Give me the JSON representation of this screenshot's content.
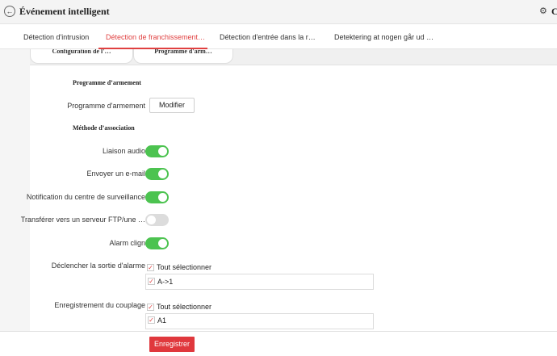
{
  "header": {
    "back_icon": "back-arrow-icon",
    "title": "Événement intelligent",
    "gear_icon": "gear-icon",
    "gear_label": "C"
  },
  "tabs": [
    {
      "label": "Détection d'intrusion",
      "active": false
    },
    {
      "label": "Détection de franchissement…",
      "active": true
    },
    {
      "label": "Détection d'entrée dans la r…",
      "active": false
    },
    {
      "label": "Detektering at nogen går ud …",
      "active": false
    }
  ],
  "subtabs": [
    {
      "label": "Configuration de l'…"
    },
    {
      "label": "Programme d'arm…"
    }
  ],
  "arming": {
    "section_title": "Programme d’armement",
    "label": "Programme d'armement",
    "modify_button": "Modifier"
  },
  "linkage": {
    "section_title": "Méthode d’association",
    "options": [
      {
        "label": "Liaison audio",
        "enabled": true
      },
      {
        "label": "Envoyer un e-mail",
        "enabled": true
      },
      {
        "label": "Notification du centre de surveillance",
        "enabled": true
      },
      {
        "label": "Transférer vers un serveur FTP/une …",
        "enabled": false
      },
      {
        "label": "Alarm clign",
        "enabled": true
      }
    ]
  },
  "alarm_output": {
    "label": "Déclencher la sortie d'alarme",
    "select_all": "Tout sélectionner",
    "items": [
      "A->1"
    ]
  },
  "recording": {
    "label": "Enregistrement du couplage",
    "select_all": "Tout sélectionner",
    "items": [
      "A1"
    ]
  },
  "footer": {
    "save_button": "Enregistrer"
  },
  "colors": {
    "accent": "#e04040",
    "toggle_on": "#4cc350",
    "toggle_off": "#dcdcdc",
    "save_button": "#e0383d"
  }
}
